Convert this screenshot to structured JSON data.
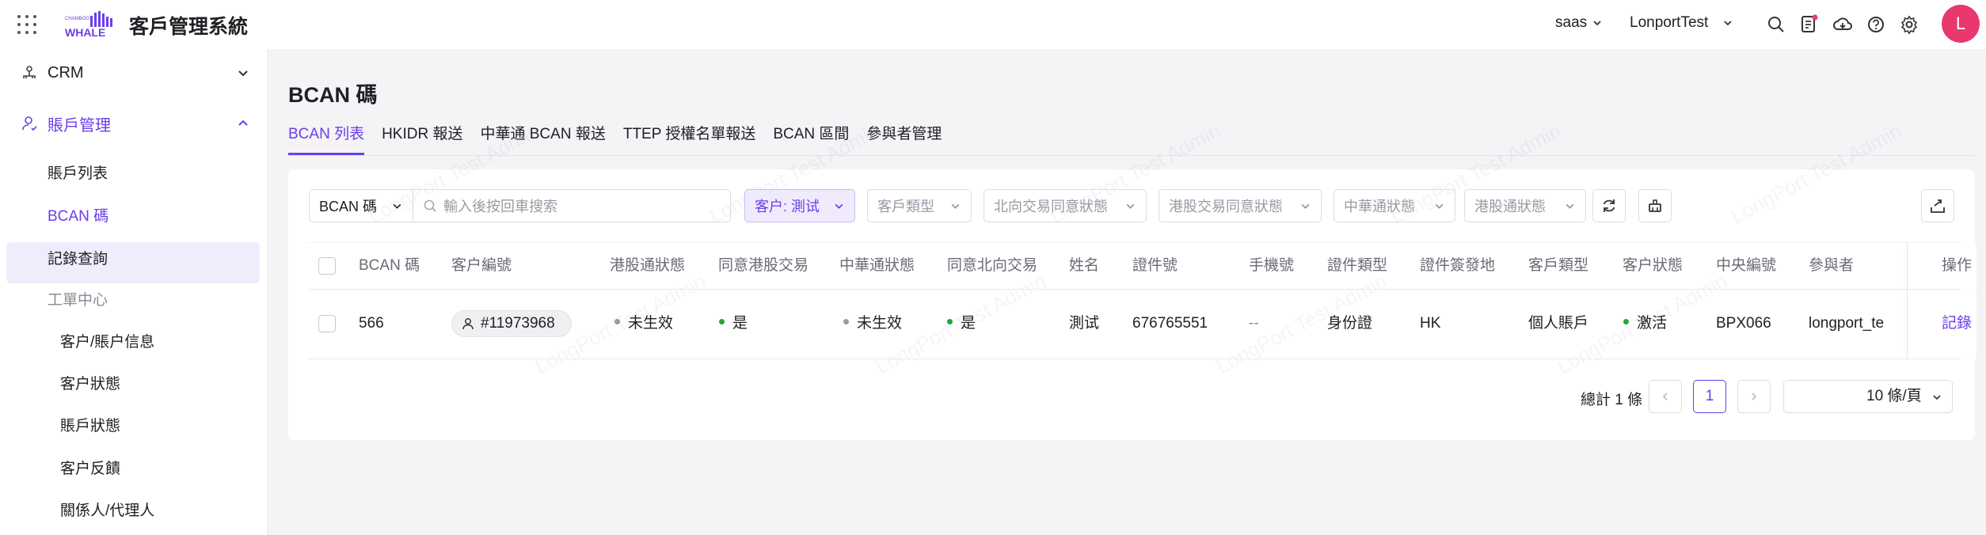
{
  "app": {
    "title": "客戶管理系統",
    "logo_small_text": "CHAMBOO",
    "logo_text": "WHALE"
  },
  "topbar": {
    "tenant": "saas",
    "account": "LonportTest",
    "avatar_letter": "L"
  },
  "sidebar": {
    "groups": [
      {
        "label": "CRM",
        "expanded": false
      },
      {
        "label": "賬戶管理",
        "expanded": true
      }
    ],
    "items": [
      "賬戶列表",
      "BCAN 碼",
      "記錄查詢"
    ],
    "section": "工單中心",
    "subitems": [
      "客户/賬户信息",
      "客户狀態",
      "賬戶狀態",
      "客户反饋",
      "關係人/代理人"
    ]
  },
  "page": {
    "title": "BCAN 碼",
    "tabs": [
      "BCAN 列表",
      "HKIDR 報送",
      "中華通 BCAN 報送",
      "TTEP 授權名單報送",
      "BCAN 區間",
      "參與者管理"
    ],
    "active_tab": 0
  },
  "filters": {
    "field_select": "BCAN 碼",
    "search_placeholder": "輸入後按回車搜索",
    "customer_filter": "客户: 測试",
    "dropdowns": [
      "客戶類型",
      "北向交易同意狀態",
      "港股交易同意狀態",
      "中華通狀態",
      "港股通狀態"
    ]
  },
  "table": {
    "columns": [
      "BCAN 碼",
      "客户編號",
      "港股通狀態",
      "同意港股交易",
      "中華通狀態",
      "同意北向交易",
      "姓名",
      "證件號",
      "手機號",
      "證件類型",
      "證件簽發地",
      "客戶類型",
      "客户狀態",
      "中央編號",
      "參與者",
      "操作"
    ],
    "rows": [
      {
        "bcan": "566",
        "customer_no": "#11973968",
        "hk_connect_status": "未生效",
        "agree_hk_trade": "是",
        "china_connect_status": "未生效",
        "agree_northbound": "是",
        "name": "測试",
        "id_no": "676765551",
        "mobile": "--",
        "id_type": "身份證",
        "id_issue_place": "HK",
        "customer_type": "個人賬戶",
        "customer_status": "激活",
        "central_no": "BPX066",
        "participant": "longport_te",
        "action": "記錄"
      }
    ]
  },
  "pagination": {
    "total_text": "總計 1 條",
    "current_page": "1",
    "page_size": "10 條/頁"
  },
  "watermark": "LongPort Test Admin",
  "colors": {
    "accent": "#6c3ee8",
    "dot_gray": "#9a9aa3",
    "dot_green": "#27a33a",
    "avatar": "#e8386e"
  }
}
